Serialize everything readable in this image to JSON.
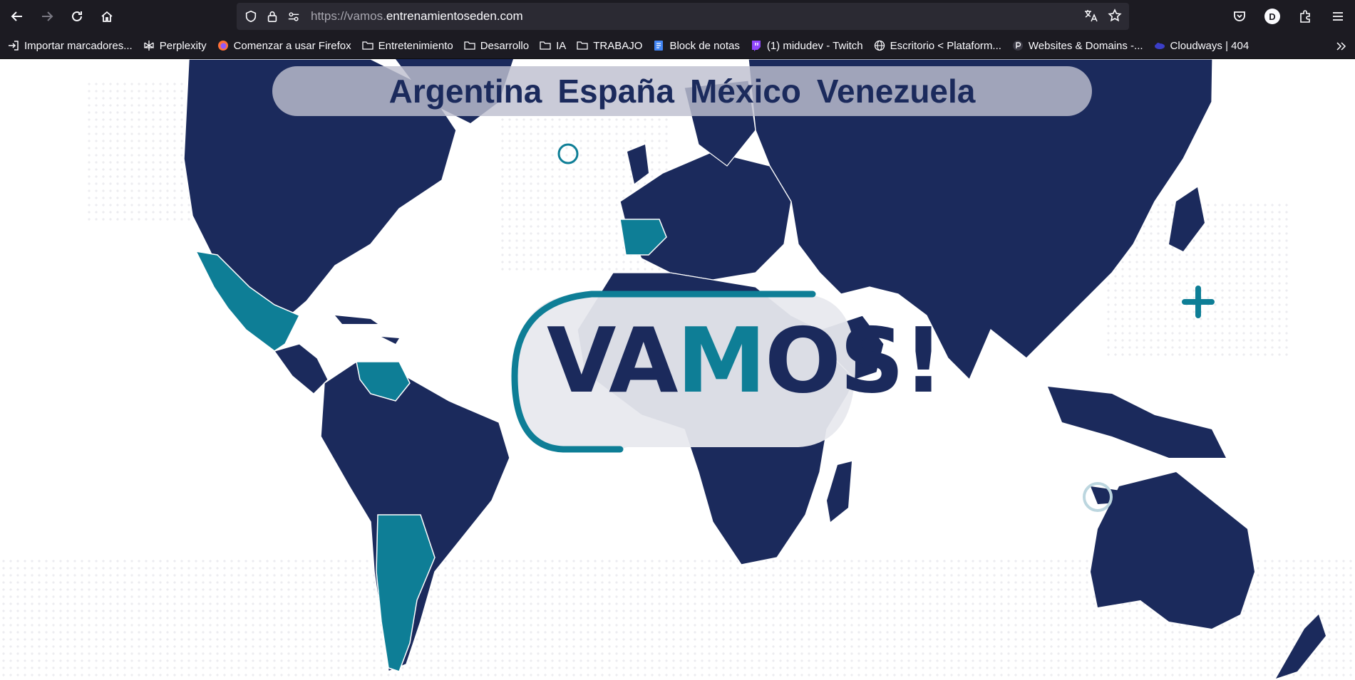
{
  "browser": {
    "url_prefix": "https://vamos.",
    "url_domain": "entrenamientoseden.com",
    "profile_initial": "D"
  },
  "bookmarks": [
    {
      "label": "Importar marcadores...",
      "icon": "import-icon"
    },
    {
      "label": "Perplexity",
      "icon": "perplexity-icon"
    },
    {
      "label": "Comenzar a usar Firefox",
      "icon": "firefox-icon"
    },
    {
      "label": "Entretenimiento",
      "icon": "folder-icon"
    },
    {
      "label": "Desarrollo",
      "icon": "folder-icon"
    },
    {
      "label": "IA",
      "icon": "folder-icon"
    },
    {
      "label": "TRABAJO",
      "icon": "folder-icon"
    },
    {
      "label": "Block de notas",
      "icon": "docs-icon"
    },
    {
      "label": "(1) midudev - Twitch",
      "icon": "twitch-icon"
    },
    {
      "label": "Escritorio < Plataform...",
      "icon": "globe-icon"
    },
    {
      "label": "Websites & Domains -...",
      "icon": "plesk-icon"
    },
    {
      "label": "Cloudways | 404",
      "icon": "cloudways-icon"
    }
  ],
  "page": {
    "countries": [
      "Argentina",
      "España",
      "México",
      "Venezuela"
    ],
    "logo_text_a": "VA",
    "logo_text_m": "M",
    "logo_text_b": "OS!"
  },
  "colors": {
    "navy": "#1b2a5c",
    "teal": "#0e7e96",
    "browser_bg": "#1c1b22"
  }
}
